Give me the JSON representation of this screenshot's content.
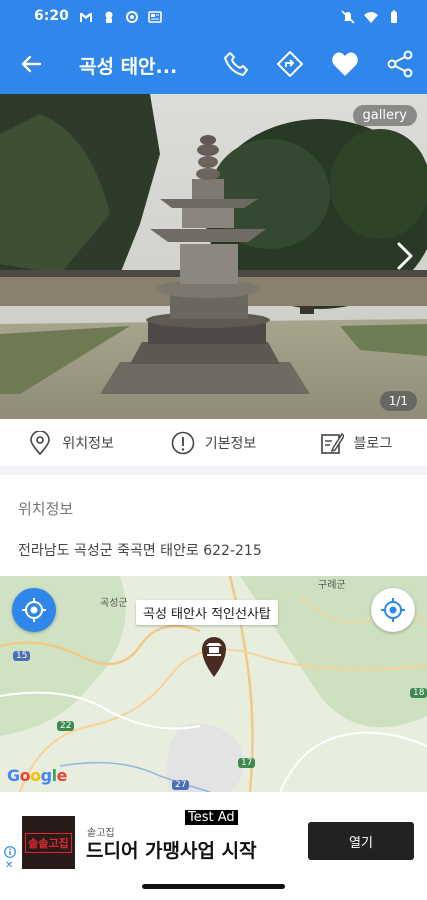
{
  "status_bar": {
    "time": "6:20",
    "left_icons": [
      "gmail-icon",
      "notification-icon",
      "settings-icon",
      "news-icon"
    ],
    "right_icons": [
      "mute-icon",
      "wifi-icon",
      "battery-icon"
    ]
  },
  "app_bar": {
    "title": "곡성 태안...",
    "actions": [
      "phone-icon",
      "directions-icon",
      "heart-icon",
      "share-icon"
    ],
    "accent_color": "#2f86eb"
  },
  "hero": {
    "gallery_label": "gallery",
    "counter": "1/1"
  },
  "tabs": [
    {
      "label": "위치정보",
      "icon": "location-pin-icon"
    },
    {
      "label": "기본정보",
      "icon": "info-icon"
    },
    {
      "label": "블로그",
      "icon": "blog-edit-icon"
    }
  ],
  "location": {
    "section_title": "위치정보",
    "address": "전라남도 곡성군 죽곡면 태안로 622-215"
  },
  "map": {
    "marker_label": "곡성 태안사 적인선사탑",
    "place_labels": [
      "곡성군",
      "구례군"
    ],
    "road_numbers": [
      "15",
      "22",
      "17",
      "18",
      "27"
    ],
    "attribution": [
      "G",
      "o",
      "o",
      "g",
      "l",
      "e"
    ]
  },
  "ad": {
    "test_label": "Test Ad",
    "advertiser": "솥고집",
    "logo_text": "솥솥고집",
    "headline": "드디어 가맹사업 시작",
    "cta": "열기",
    "close": "✕"
  }
}
